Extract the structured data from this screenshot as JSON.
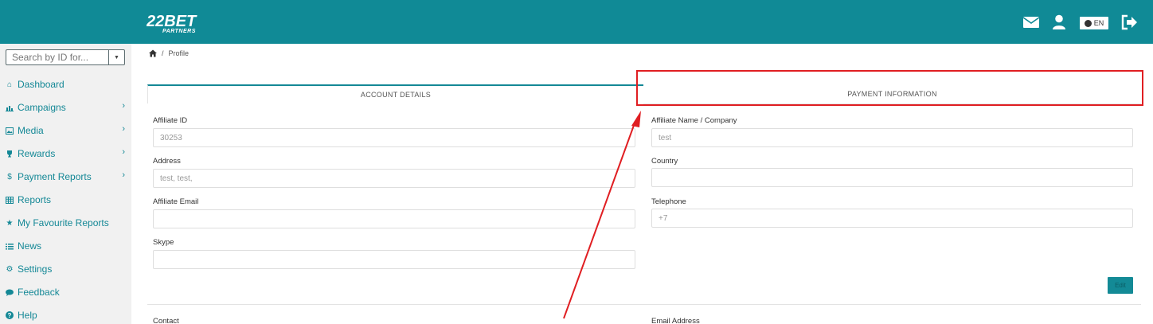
{
  "header": {
    "logo_text": "22BET PARTNERS",
    "language": "EN"
  },
  "sidebar": {
    "search_placeholder": "Search by ID for...",
    "items": [
      {
        "label": "Dashboard",
        "icon": "home-icon",
        "has_submenu": false
      },
      {
        "label": "Campaigns",
        "icon": "bar-chart-icon",
        "has_submenu": true
      },
      {
        "label": "Media",
        "icon": "image-icon",
        "has_submenu": true
      },
      {
        "label": "Rewards",
        "icon": "trophy-icon",
        "has_submenu": true
      },
      {
        "label": "Payment Reports",
        "icon": "dollar-icon",
        "has_submenu": true
      },
      {
        "label": "Reports",
        "icon": "table-icon",
        "has_submenu": false
      },
      {
        "label": "My Favourite Reports",
        "icon": "star-icon",
        "has_submenu": false
      },
      {
        "label": "News",
        "icon": "list-icon",
        "has_submenu": false
      },
      {
        "label": "Settings",
        "icon": "gear-icon",
        "has_submenu": false
      },
      {
        "label": "Feedback",
        "icon": "comment-icon",
        "has_submenu": false
      },
      {
        "label": "Help",
        "icon": "question-icon",
        "has_submenu": false
      }
    ]
  },
  "breadcrumb": {
    "separator": "/",
    "current": "Profile"
  },
  "tabs": {
    "account": "ACCOUNT DETAILS",
    "payment": "PAYMENT INFORMATION"
  },
  "form": {
    "affiliate_id": {
      "label": "Affiliate ID",
      "value": "30253"
    },
    "affiliate_name": {
      "label": "Affiliate Name / Company",
      "value": "test"
    },
    "address": {
      "label": "Address",
      "value": "test, test,"
    },
    "country": {
      "label": "Country",
      "value": ""
    },
    "affiliate_email": {
      "label": "Affiliate Email",
      "value": ""
    },
    "telephone": {
      "label": "Telephone",
      "value": "+7"
    },
    "skype": {
      "label": "Skype",
      "value": ""
    },
    "edit_label": "Edit",
    "contact_label": "Contact",
    "email_address_label": "Email Address"
  },
  "colors": {
    "brand_teal": "#108a96",
    "annotation_red": "#e01e22"
  }
}
